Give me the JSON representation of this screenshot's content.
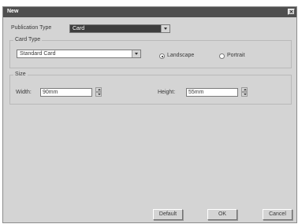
{
  "window": {
    "title": "New",
    "close_icon": "close-icon"
  },
  "publication": {
    "label": "Publication Type",
    "value": "Card"
  },
  "card_type": {
    "legend": "Card Type",
    "value": "Standard Card",
    "orientation": [
      {
        "label": "Landscape",
        "selected": true
      },
      {
        "label": "Portrait",
        "selected": false
      }
    ]
  },
  "size": {
    "legend": "Size",
    "width_label": "Width:",
    "width_value": "90mm",
    "height_label": "Height:",
    "height_value": "55mm"
  },
  "buttons": {
    "default": "Default",
    "ok": "OK",
    "cancel": "Cancel"
  }
}
